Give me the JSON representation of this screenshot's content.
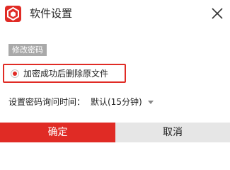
{
  "window": {
    "title": "软件设置",
    "icon": "app-logo-icon",
    "close_icon": "close-icon",
    "accent_color": "#e02b25"
  },
  "section": {
    "label": "修改密码"
  },
  "option": {
    "label": "加密成功后删除原文件",
    "checked": true
  },
  "interval": {
    "label": "设置密码询问时间：",
    "selected": "默认(15分钟)"
  },
  "buttons": {
    "ok": "确定",
    "cancel": "取消"
  }
}
